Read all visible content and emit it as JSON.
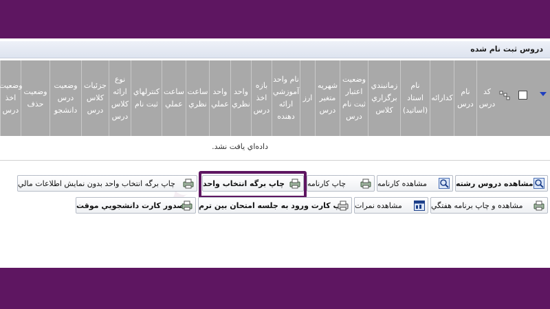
{
  "panel": {
    "title": "دروس ثبت نام شده",
    "empty_message": "داده‌اي يافت نشد."
  },
  "columns": [
    {
      "key": "code",
      "label": "كد درس"
    },
    {
      "key": "name",
      "label": "نام درس"
    },
    {
      "key": "group",
      "label": "كدارائه"
    },
    {
      "key": "teacher",
      "label": "نام استاد (اساتيد)"
    },
    {
      "key": "schedule",
      "label": "زمانبندي برگزاري كلاس"
    },
    {
      "key": "credit_status",
      "label": "وضعيت اعتبار ثبت نام درس"
    },
    {
      "key": "tuition",
      "label": "شهريه متغير درس"
    },
    {
      "key": "currency",
      "label": "ارز"
    },
    {
      "key": "unit_name",
      "label": "نام واحد آموزشي ارائه دهنده"
    },
    {
      "key": "range",
      "label": "بازه اخذ درس"
    },
    {
      "key": "theory_units",
      "label": "واحد نظري"
    },
    {
      "key": "practical_units",
      "label": "واحد عملي"
    },
    {
      "key": "theory_hours",
      "label": "ساعت نظري"
    },
    {
      "key": "practical_hours",
      "label": "ساعت عملي"
    },
    {
      "key": "reg_checks",
      "label": "كنترلهاي ثبت نام"
    },
    {
      "key": "class_type",
      "label": "نوع ارائه كلاس درس"
    },
    {
      "key": "class_details",
      "label": "جزئيات كلاس درس"
    },
    {
      "key": "student_status",
      "label": "وضعيت درس دانشجو"
    },
    {
      "key": "delete_status",
      "label": "وضعيت حذف"
    },
    {
      "key": "take_status",
      "label": "وضعيت اخذ درس"
    }
  ],
  "buttons": {
    "view_field_courses": "مشاهده دروس رشته",
    "view_report_card": "مشاهده كارنامه",
    "print_report_card": "چاپ كارنامه",
    "print_selection_form": "چاپ برگه انتخاب واحد",
    "print_selection_no_finance": "چاپ برگه انتخاب واحد بدون نمايش اطلاعات مالي",
    "view_print_weekly": "مشاهده و چاپ برنامه هفتگي",
    "view_grades": "مشاهده نمرات",
    "print_exam_card": "چاپ كارت ورود به جلسه امتحان بين ترم",
    "issue_temp_card": "صدور كارت دانشجويي موقت"
  },
  "icons": {
    "sort": "sort-down-icon",
    "grid": "grid-settings-icon",
    "magnifier": "magnifier-icon",
    "printer": "printer-icon",
    "calendar": "calendar-icon"
  },
  "colors": {
    "frame": "#5e1661",
    "header_bg": "#a9a9a9",
    "highlight": "#5e1661"
  }
}
